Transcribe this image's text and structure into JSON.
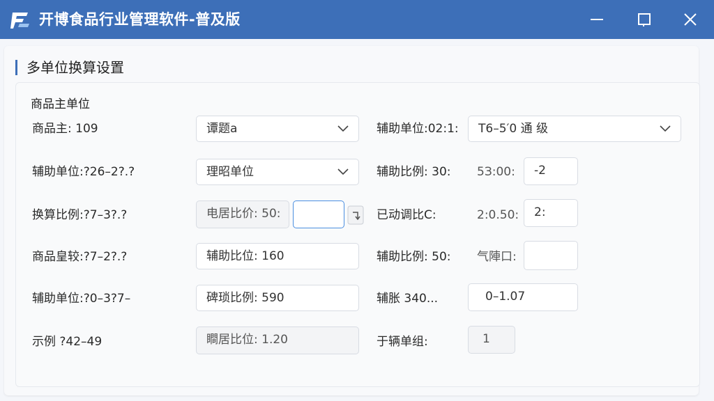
{
  "window": {
    "title": "开博食品行业管理软件-普及版",
    "accent": "#3d6fb8"
  },
  "section": {
    "title": "多单位换算设置"
  },
  "form": {
    "group_label": "商品主单位",
    "rows": [
      {
        "left_label": "商品主: 109",
        "left_value": "谭题a",
        "right_label": "辅助单位:02:1:",
        "right_value": "T6–5′0 通 级"
      },
      {
        "left_label": "辅助单位:?26–2?.?",
        "left_value": "理昭单位",
        "right_label": "辅助比例: 30:",
        "right_text": "5З:00:",
        "right_value": "-2"
      },
      {
        "left_label": "换算比例:?7–3?.?",
        "left_value": "电居比价: 50:",
        "right_label": "已动调比C:",
        "right_text": "2:0.50:",
        "right_value": "2:"
      },
      {
        "left_label": "商品皇较:?7–2?.?",
        "left_value": "辅助比位: 160",
        "right_label": "辅助比例: 50:",
        "right_text": "气陣口:",
        "right_value": ""
      },
      {
        "left_label": "辅助单位:?0–3?7–",
        "left_value": "碑琐比例: 590",
        "right_label": "辅胀 340...",
        "right_value": "0–1.07"
      },
      {
        "left_label": "示例 ?42–49",
        "left_value": "瞷居比位: 1.20",
        "right_label": "于辆单组:",
        "right_value": "1"
      }
    ]
  }
}
